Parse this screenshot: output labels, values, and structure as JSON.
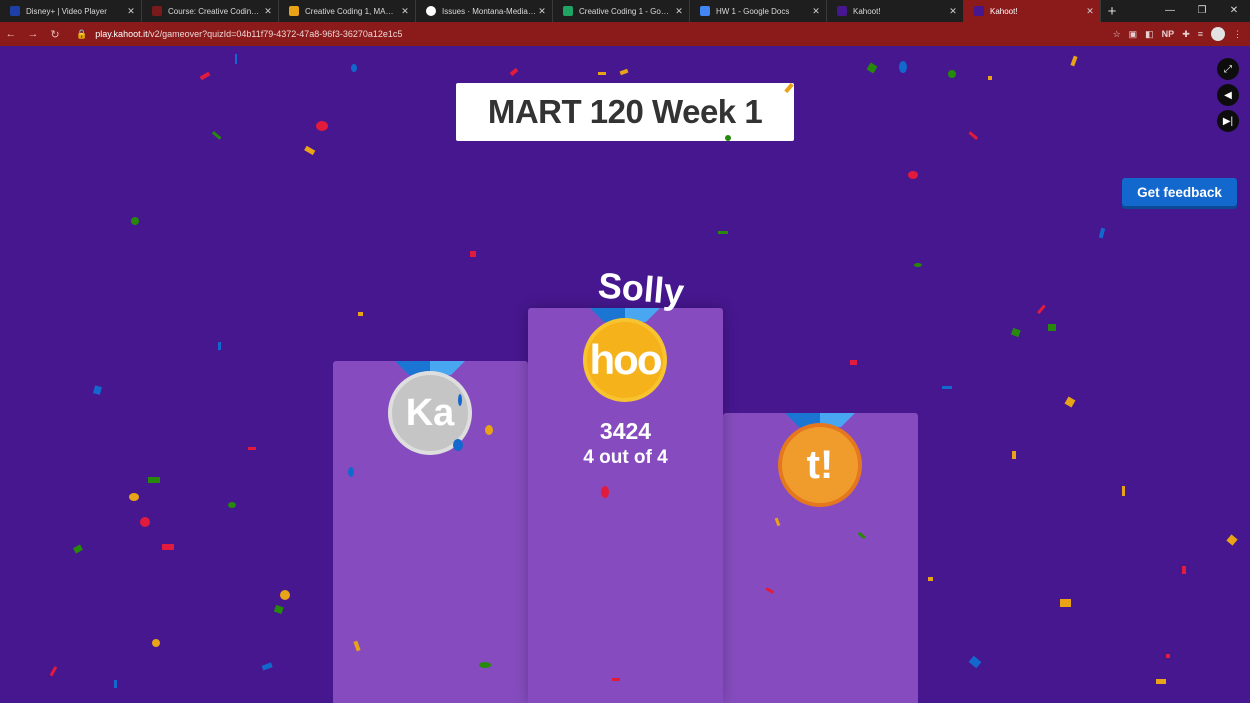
{
  "browser": {
    "tabs": [
      {
        "title": "Disney+ | Video Player",
        "color": "#1f3fa8",
        "active": false
      },
      {
        "title": "Course: Creative Coding I (S...",
        "color": "#7a1b1b",
        "active": false
      },
      {
        "title": "Creative Coding 1, MART 12...",
        "color": "#e8a317",
        "active": false
      },
      {
        "title": "Issues · Montana-Media-Ar...",
        "color": "#ffffff",
        "active": false
      },
      {
        "title": "Creative Coding 1 - Google...",
        "color": "#1fa463",
        "active": false
      },
      {
        "title": "HW 1 - Google Docs",
        "color": "#4285f4",
        "active": false
      },
      {
        "title": "Kahoot!",
        "color": "#46178f",
        "active": false
      },
      {
        "title": "Kahoot!",
        "color": "#46178f",
        "active": true
      }
    ],
    "url_host": "play.kahoot.it",
    "url_path": "/v2/gameover?quizId=04b11f79-4372-47a8-96f3-36270a12e1c5",
    "ext_np": "NP"
  },
  "game": {
    "quiz_title": "MART 120 Week 1",
    "feedback_label": "Get feedback",
    "first": {
      "name": "Solly",
      "score": "3424",
      "correct": "4 out of 4",
      "medal_text": "hoo"
    },
    "second": {
      "medal_text": "Ka"
    },
    "third": {
      "medal_text": "t!"
    }
  },
  "colors": {
    "background": "#46178f",
    "podium": "#864cbf",
    "feedback_button": "#1368ce",
    "gold": "#f5b21a",
    "silver": "#c5c5c5",
    "bronze": "#f09c2c"
  }
}
